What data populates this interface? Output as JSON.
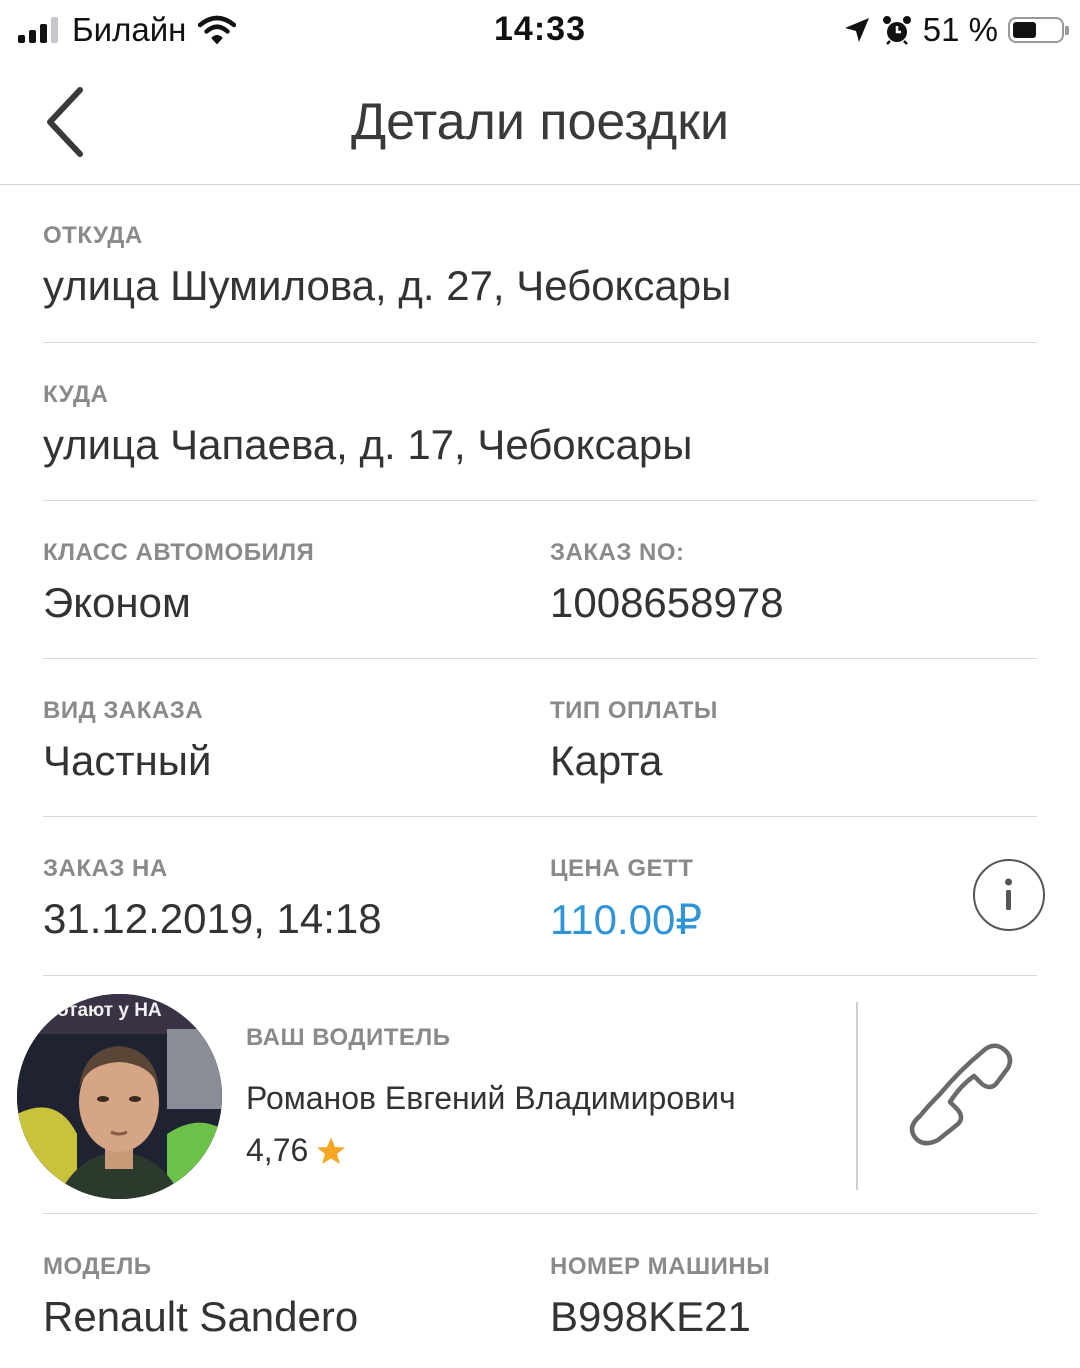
{
  "status_bar": {
    "carrier": "Билайн",
    "time": "14:33",
    "battery_percent": "51 %",
    "battery_level": 0.51,
    "signal_bars": 3,
    "icons": [
      "signal-icon",
      "wifi-icon",
      "location-arrow-icon",
      "alarm-icon",
      "battery-icon"
    ]
  },
  "nav": {
    "title": "Детали поездки",
    "back_icon": "chevron-left-icon"
  },
  "trip": {
    "from_label": "ОТКУДА",
    "from_value": "улица Шумилова, д. 27, Чебоксары",
    "to_label": "КУДА",
    "to_value": "улица Чапаева, д. 17, Чебоксары",
    "car_class_label": "КЛАСС АВТОМОБИЛЯ",
    "car_class_value": "Эконом",
    "order_no_label": "ЗАКАЗ NO:",
    "order_no_value": "1008658978",
    "order_kind_label": "ВИД ЗАКАЗА",
    "order_kind_value": "Частный",
    "payment_label": "ТИП ОПЛАТЫ",
    "payment_value": "Карта",
    "order_time_label": "ЗАКАЗ НА",
    "order_time_value": "31.12.2019, 14:18",
    "price_label": "ЦЕНА GETT",
    "price_value": "110.00₽",
    "price_color": "#2f95d7"
  },
  "driver": {
    "label": "ВАШ ВОДИТЕЛЬ",
    "name": "Романов Евгений Владимирович",
    "rating": "4,76",
    "photo_caption": "отают у НА",
    "star_color": "#f5a623"
  },
  "vehicle": {
    "model_label": "МОДЕЛЬ",
    "model_value": "Renault Sandero",
    "plate_label": "НОМЕР МАШИНЫ",
    "plate_value": "B998KE21"
  }
}
